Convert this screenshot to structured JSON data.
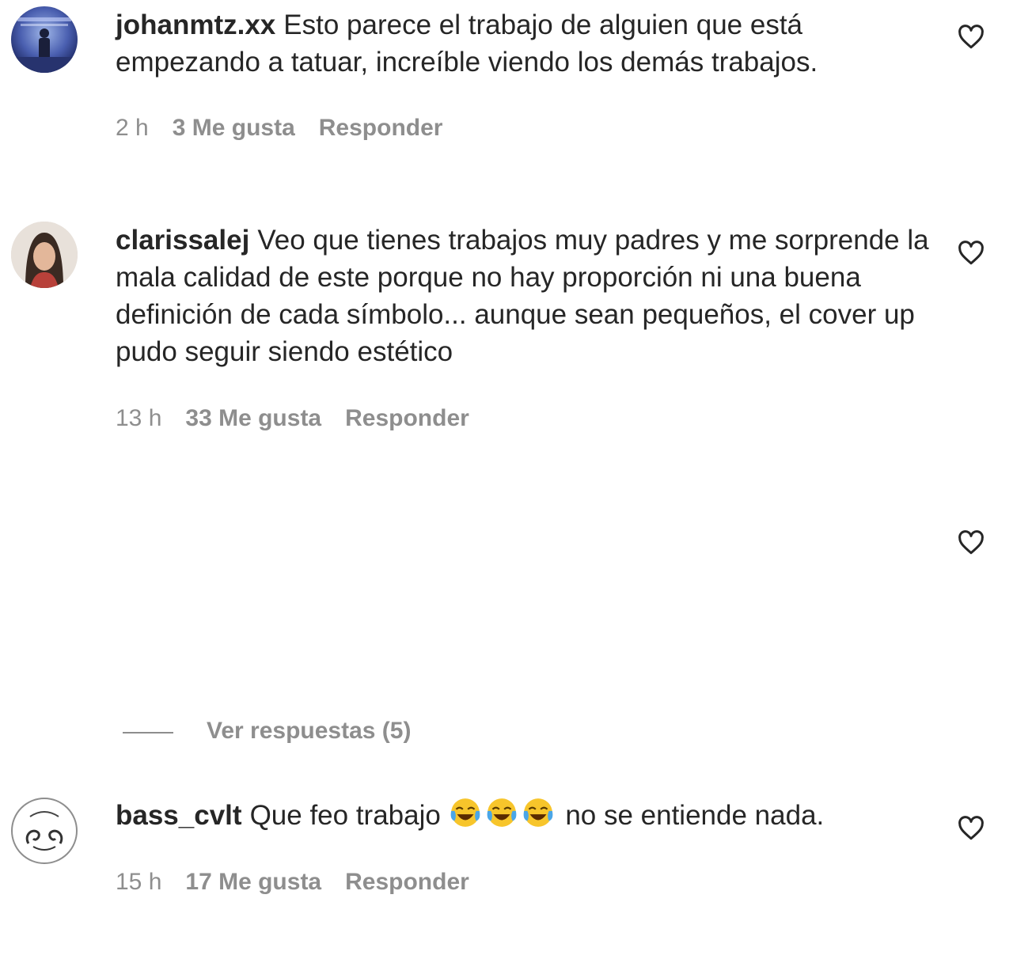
{
  "comments": [
    {
      "username": "johanmtz.xx",
      "text": "Esto parece el trabajo de alguien que está empezando a tatuar, increíble viendo los demás trabajos.",
      "time": "2 h",
      "likes": "3 Me gusta",
      "reply": "Responder"
    },
    {
      "username": "clarissalej",
      "text": "Veo que tienes trabajos muy padres y me sorprende la mala calidad de este porque no hay proporción ni una buena definición de cada símbolo... aunque sean pequeños, el cover up pudo seguir siendo estético",
      "time": "13 h",
      "likes": "33 Me gusta",
      "reply": "Responder"
    },
    {
      "username": "bass_cvlt",
      "text_before_emoji": "Que feo trabajo",
      "emoji": [
        "face-with-tears-of-joy",
        "face-with-tears-of-joy",
        "face-with-tears-of-joy"
      ],
      "text_after_emoji": "no se entiende nada.",
      "time": "15 h",
      "likes": "17 Me gusta",
      "reply": "Responder"
    }
  ],
  "view_replies_label": "Ver respuestas (5)",
  "icons": {
    "like": "heart-outline-icon",
    "emoji": "face-with-tears-of-joy"
  },
  "colors": {
    "text": "#262626",
    "secondary": "#8e8e8e",
    "background": "#ffffff"
  }
}
